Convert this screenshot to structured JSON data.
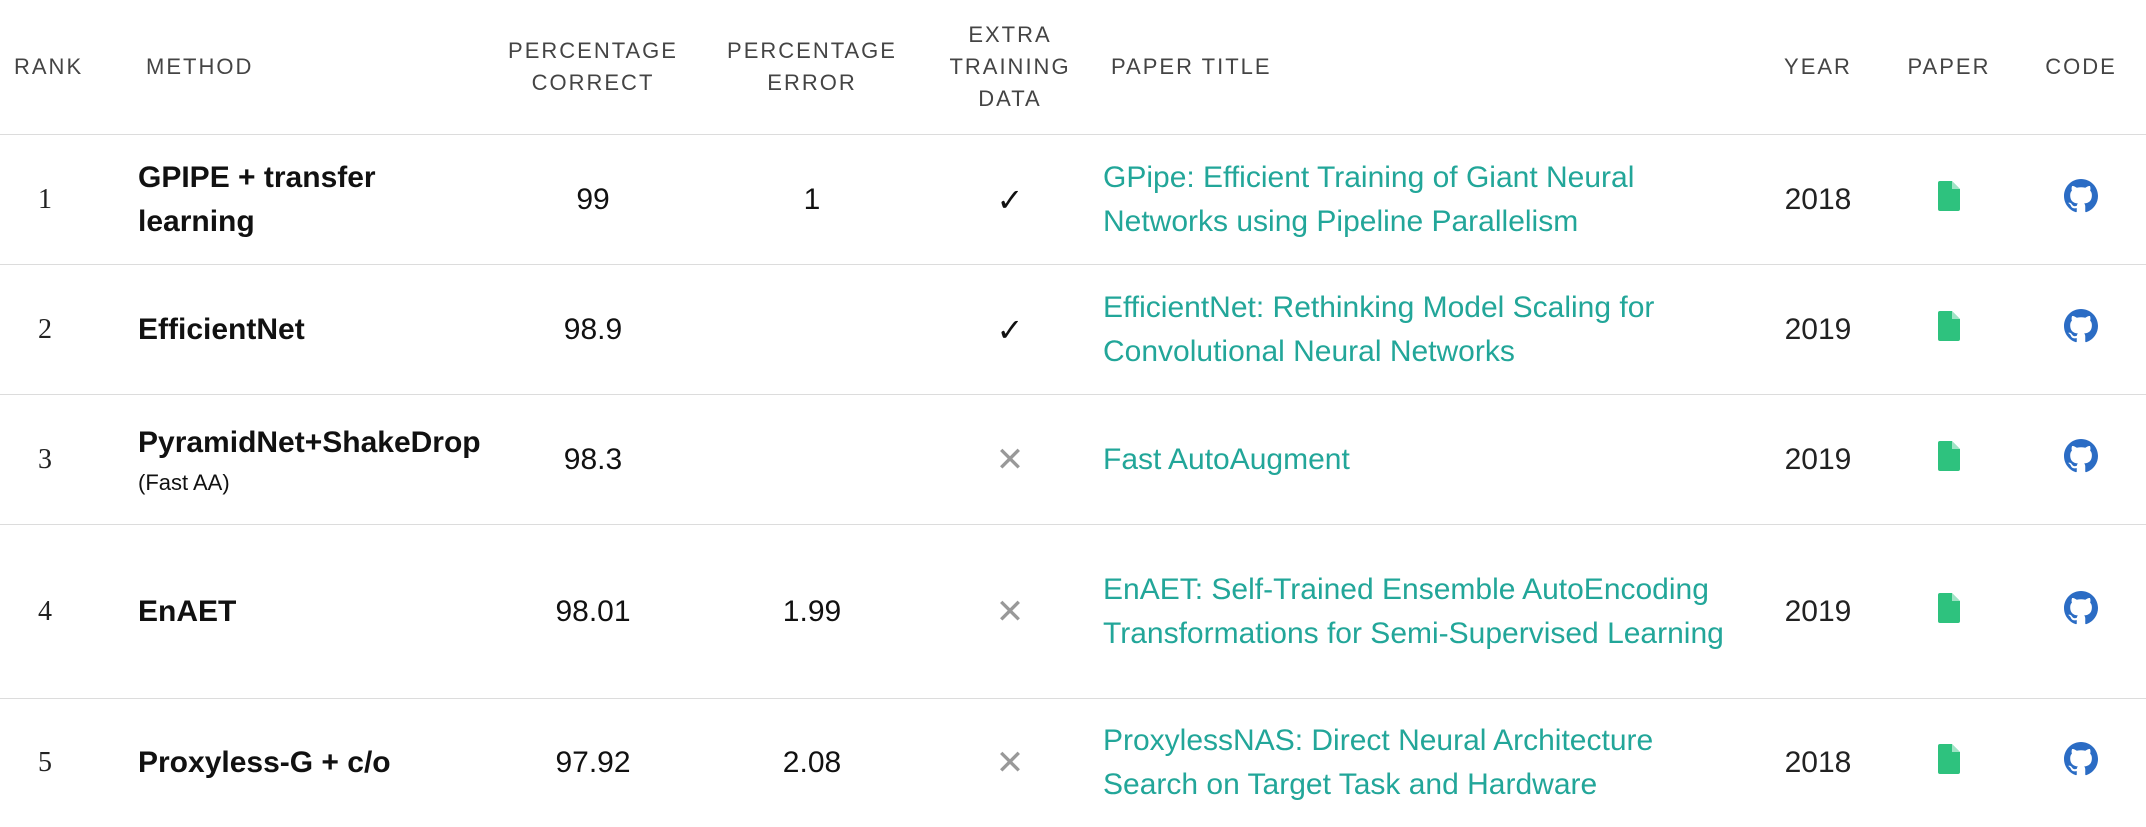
{
  "headers": {
    "rank": "RANK",
    "method": "METHOD",
    "pct_correct": "PERCENTAGE CORRECT",
    "pct_error": "PERCENTAGE ERROR",
    "extra_data": "EXTRA TRAINING DATA",
    "paper_title": "PAPER TITLE",
    "year": "YEAR",
    "paper": "PAPER",
    "code": "CODE"
  },
  "rows": [
    {
      "rank": "1",
      "method": "GPIPE + transfer learning",
      "method_sub": "",
      "pct_correct": "99",
      "pct_error": "1",
      "extra_data": "✓",
      "paper_title": "GPipe: Efficient Training of Giant Neural Networks using Pipeline Parallelism",
      "year": "2018"
    },
    {
      "rank": "2",
      "method": "EfficientNet",
      "method_sub": "",
      "pct_correct": "98.9",
      "pct_error": "",
      "extra_data": "✓",
      "paper_title": "EfficientNet: Rethinking Model Scaling for Convolutional Neural Networks",
      "year": "2019"
    },
    {
      "rank": "3",
      "method": "PyramidNet+ShakeDrop",
      "method_sub": "(Fast AA)",
      "pct_correct": "98.3",
      "pct_error": "",
      "extra_data": "✕",
      "paper_title": "Fast AutoAugment",
      "year": "2019"
    },
    {
      "rank": "4",
      "method": "EnAET",
      "method_sub": "",
      "pct_correct": "98.01",
      "pct_error": "1.99",
      "extra_data": "✕",
      "paper_title": "EnAET: Self-Trained Ensemble AutoEncoding Transformations for Semi-Supervised Learning",
      "year": "2019"
    },
    {
      "rank": "5",
      "method": "Proxyless-G + c/o",
      "method_sub": "",
      "pct_correct": "97.92",
      "pct_error": "2.08",
      "extra_data": "✕",
      "paper_title": "ProxylessNAS: Direct Neural Architecture Search on Target Task and Hardware",
      "year": "2018"
    }
  ],
  "icons": {
    "paper": "paper-file-icon",
    "code": "github-icon"
  },
  "colors": {
    "link": "#22a699",
    "paper_icon": "#2ec27e",
    "code_icon": "#2b6cc4",
    "check": "#111111",
    "cross": "#999999"
  }
}
